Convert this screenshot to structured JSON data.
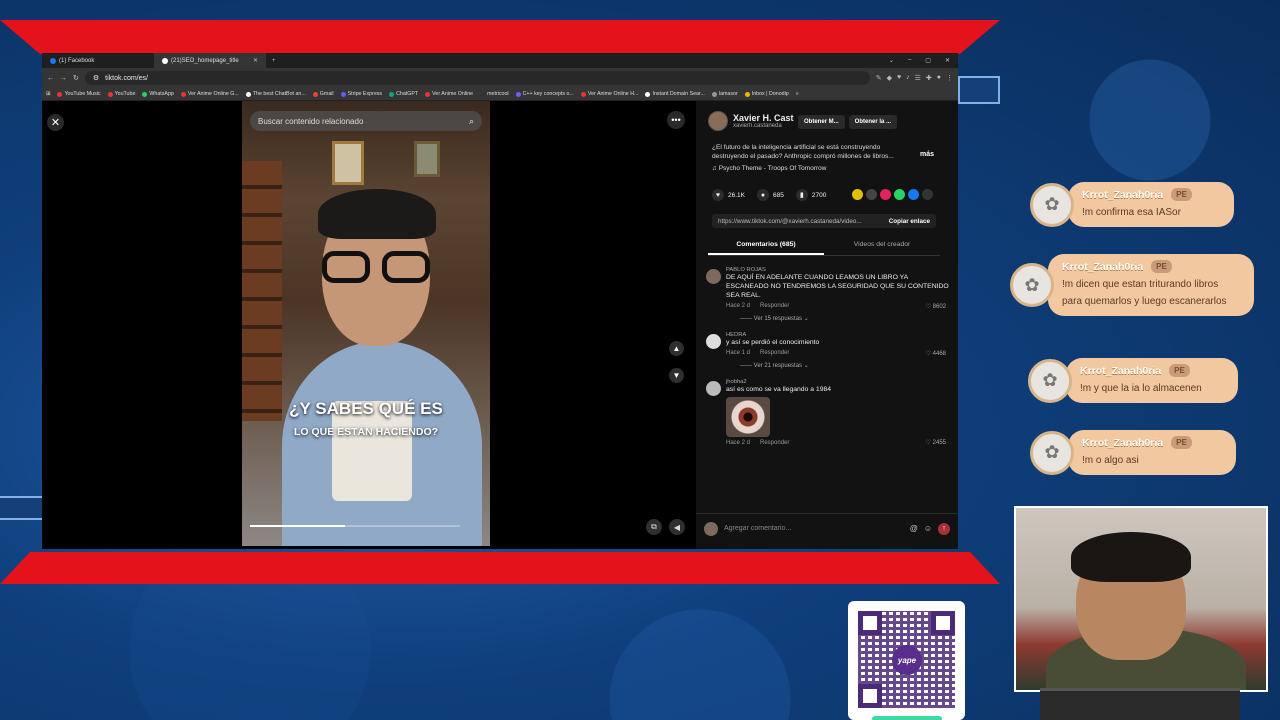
{
  "browser": {
    "tabs": [
      {
        "label": "(1) Facebook",
        "active": false
      },
      {
        "label": "(21)SEO_homepage_title",
        "active": true
      }
    ],
    "url": "tiktok.com/es/",
    "bookmarks": [
      "YouTube Music",
      "YouTube",
      "WhatsApp",
      "Ver Anime Online G...",
      "The best ChatBot an...",
      "Gmail",
      "Stripe Express",
      "ChatGPT",
      "Ver Anime Online",
      "metricool",
      "C++ key concepts o...",
      "Ver Anime Online H...",
      "Instant Domain Sear...",
      "lamasor",
      "Inbox | Donodip"
    ]
  },
  "video": {
    "search_placeholder": "Buscar contenido relacionado",
    "caption_main": "¿Y SABES QUÉ ES",
    "caption_sub": "LO QUE ESTÁN HACIENDO?",
    "progress": 0.45
  },
  "panel": {
    "creator_name": "Xavier H. Cast",
    "creator_handle": "xavierh.castaneda",
    "get_buttons": [
      "Obtener M...",
      "Obtener la ..."
    ],
    "description": "¿El futuro de la inteligencia artificial se está construyendo destruyendo el pasado? Anthropic compró millones de libros...",
    "more": "más",
    "music": "Psycho Theme - Troops Of Tomorrow",
    "likes": "26.1K",
    "comments_count": "685",
    "saves": "2700",
    "link": "https://www.tiktok.com/@xavierh.castaneda/video...",
    "copy_link": "Copiar enlace",
    "tab_comments": "Comentarios (685)",
    "tab_creator": "Videos del creador",
    "comments": [
      {
        "user": "PABLO ROJAS",
        "text": "DE AQUÍ EN ADELANTE CUANDO LEAMOS UN LIBRO YA ESCANEADO NO TENDREMOS LA SEGURIDAD QUE SU CONTENIDO SEA REAL.",
        "time": "Hace 2 d",
        "reply": "Responder",
        "likes": "8602",
        "replies": "Ver 15 respuestas"
      },
      {
        "user": "HEDRA",
        "text": "y así se perdió el conocimiento",
        "time": "Hace 1 d",
        "reply": "Responder",
        "likes": "4468",
        "replies": "Ver 21 respuestas"
      },
      {
        "user": "jhobha2",
        "text": "así es como se va llegando a 1984",
        "time": "Hace 2 d",
        "reply": "Responder",
        "likes": "2455"
      }
    ],
    "add_comment_placeholder": "Agregar comentario..."
  },
  "chat": [
    {
      "name": "Krrot_Zanah0ria",
      "badge": "PE",
      "text": "!m confirma esa IASor"
    },
    {
      "name": "Krrot_Zanah0ria",
      "badge": "PE",
      "text": "!m dicen que estan triturando libros para quemarlos y luego escanerarlos"
    },
    {
      "name": "Krrot_Zanah0ria",
      "badge": "PE",
      "text": "!m y que la ia lo almacenen"
    },
    {
      "name": "Krrot_Zanah0ria",
      "badge": "PE",
      "text": "!m o algo asi"
    }
  ],
  "qr": {
    "logo_text": "yape",
    "brand_color": "#5a2d8c"
  },
  "colors": {
    "overlay_red": "#e4121a",
    "chat_bubble": "#f2c8a1"
  }
}
